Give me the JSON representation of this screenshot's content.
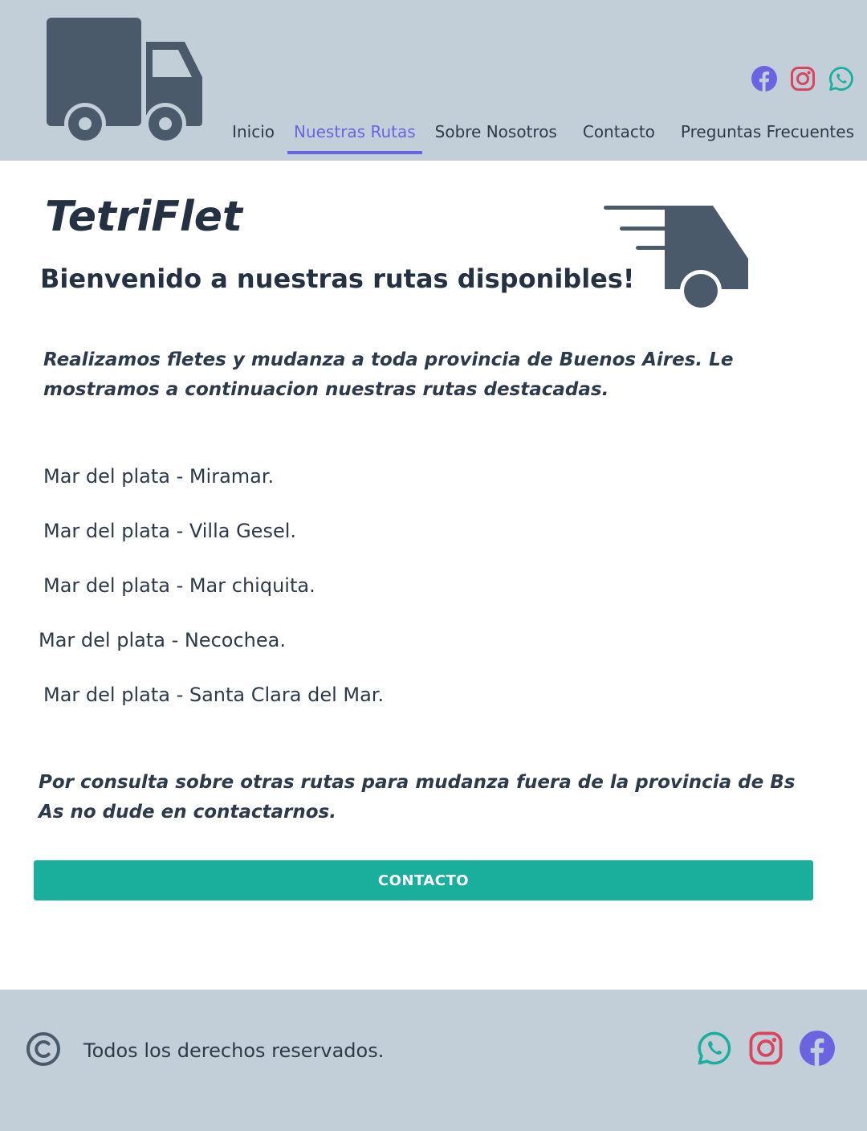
{
  "header": {
    "logo_icon": "truck-icon",
    "social": [
      {
        "name": "facebook",
        "icon": "facebook-icon",
        "color": "#6c63e0"
      },
      {
        "name": "instagram",
        "icon": "instagram-icon",
        "color": "#d9455f"
      },
      {
        "name": "whatsapp",
        "icon": "whatsapp-icon",
        "color": "#1aaf9d"
      }
    ],
    "nav": [
      {
        "label": "Inicio",
        "active": false
      },
      {
        "label": "Nuestras Rutas",
        "active": true
      },
      {
        "label": "Sobre Nosotros",
        "active": false
      },
      {
        "label": "Contacto",
        "active": false
      },
      {
        "label": "Preguntas Frecuentes",
        "active": false
      }
    ]
  },
  "main": {
    "brand": "TetriFlet",
    "welcome": "Bienvenido a nuestras rutas disponibles!",
    "hero_icon": "fast-truck-icon",
    "intro": "Realizamos fletes y mudanza a toda provincia de Buenos Aires. Le mostramos a continuacion nuestras rutas destacadas.",
    "routes": [
      "Mar del plata - Miramar.",
      "Mar del plata - Villa Gesel.",
      "Mar del plata - Mar chiquita.",
      "Mar del plata - Necochea.",
      "Mar del plata - Santa Clara del Mar."
    ],
    "outro": "Por consulta sobre otras rutas para mudanza fuera de la provincia de Bs As no dude en contactarnos.",
    "cta_label": "CONTACTO"
  },
  "footer": {
    "copyright_icon": "copyright-icon",
    "text": "Todos los derechos reservados.",
    "social": [
      {
        "name": "whatsapp",
        "icon": "whatsapp-icon"
      },
      {
        "name": "instagram",
        "icon": "instagram-icon"
      },
      {
        "name": "facebook",
        "icon": "facebook-icon"
      }
    ]
  },
  "colors": {
    "header_bg": "#c2cfd9",
    "accent": "#6c63e0",
    "cta": "#1aaf9d",
    "text": "#2d3a4a",
    "icon_dark": "#4a5a6a"
  }
}
